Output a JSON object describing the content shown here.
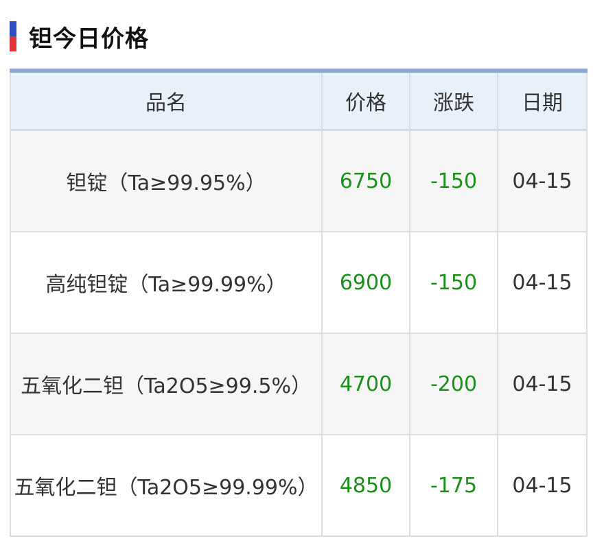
{
  "title": "钽今日价格",
  "colors": {
    "accent_top": "#2f4fc0",
    "accent_bottom": "#e0333a",
    "header_border": "#8fa5d3",
    "value_green": "#1a8f1a"
  },
  "table": {
    "headers": [
      "品名",
      "价格",
      "涨跌",
      "日期"
    ],
    "rows": [
      {
        "name": "钽锭（Ta≥99.95%）",
        "price": "6750",
        "change": "-150",
        "date": "04-15"
      },
      {
        "name": "高纯钽锭（Ta≥99.99%）",
        "price": "6900",
        "change": "-150",
        "date": "04-15"
      },
      {
        "name": "五氧化二钽（Ta2O5≥99.5%）",
        "price": "4700",
        "change": "-200",
        "date": "04-15"
      },
      {
        "name": "五氧化二钽（Ta2O5≥99.99%）",
        "price": "4850",
        "change": "-175",
        "date": "04-15"
      }
    ]
  }
}
